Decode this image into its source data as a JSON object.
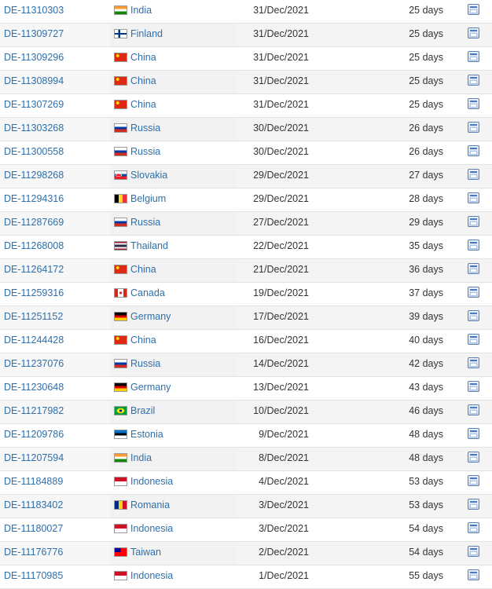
{
  "rows": [
    {
      "id": "DE-11310303",
      "country": "India",
      "flag_icon": "india-flag-icon",
      "date": "31/Dec/2021",
      "age": "25 days"
    },
    {
      "id": "DE-11309727",
      "country": "Finland",
      "flag_icon": "finland-flag-icon",
      "date": "31/Dec/2021",
      "age": "25 days"
    },
    {
      "id": "DE-11309296",
      "country": "China",
      "flag_icon": "china-flag-icon",
      "date": "31/Dec/2021",
      "age": "25 days"
    },
    {
      "id": "DE-11308994",
      "country": "China",
      "flag_icon": "china-flag-icon",
      "date": "31/Dec/2021",
      "age": "25 days"
    },
    {
      "id": "DE-11307269",
      "country": "China",
      "flag_icon": "china-flag-icon",
      "date": "31/Dec/2021",
      "age": "25 days"
    },
    {
      "id": "DE-11303268",
      "country": "Russia",
      "flag_icon": "russia-flag-icon",
      "date": "30/Dec/2021",
      "age": "26 days"
    },
    {
      "id": "DE-11300558",
      "country": "Russia",
      "flag_icon": "russia-flag-icon",
      "date": "30/Dec/2021",
      "age": "26 days"
    },
    {
      "id": "DE-11298268",
      "country": "Slovakia",
      "flag_icon": "slovakia-flag-icon",
      "date": "29/Dec/2021",
      "age": "27 days"
    },
    {
      "id": "DE-11294316",
      "country": "Belgium",
      "flag_icon": "belgium-flag-icon",
      "date": "29/Dec/2021",
      "age": "28 days"
    },
    {
      "id": "DE-11287669",
      "country": "Russia",
      "flag_icon": "russia-flag-icon",
      "date": "27/Dec/2021",
      "age": "29 days"
    },
    {
      "id": "DE-11268008",
      "country": "Thailand",
      "flag_icon": "thailand-flag-icon",
      "date": "22/Dec/2021",
      "age": "35 days"
    },
    {
      "id": "DE-11264172",
      "country": "China",
      "flag_icon": "china-flag-icon",
      "date": "21/Dec/2021",
      "age": "36 days"
    },
    {
      "id": "DE-11259316",
      "country": "Canada",
      "flag_icon": "canada-flag-icon",
      "date": "19/Dec/2021",
      "age": "37 days"
    },
    {
      "id": "DE-11251152",
      "country": "Germany",
      "flag_icon": "germany-flag-icon",
      "date": "17/Dec/2021",
      "age": "39 days"
    },
    {
      "id": "DE-11244428",
      "country": "China",
      "flag_icon": "china-flag-icon",
      "date": "16/Dec/2021",
      "age": "40 days"
    },
    {
      "id": "DE-11237076",
      "country": "Russia",
      "flag_icon": "russia-flag-icon",
      "date": "14/Dec/2021",
      "age": "42 days"
    },
    {
      "id": "DE-11230648",
      "country": "Germany",
      "flag_icon": "germany-flag-icon",
      "date": "13/Dec/2021",
      "age": "43 days"
    },
    {
      "id": "DE-11217982",
      "country": "Brazil",
      "flag_icon": "brazil-flag-icon",
      "date": "10/Dec/2021",
      "age": "46 days"
    },
    {
      "id": "DE-11209786",
      "country": "Estonia",
      "flag_icon": "estonia-flag-icon",
      "date": "9/Dec/2021",
      "age": "48 days"
    },
    {
      "id": "DE-11207594",
      "country": "India",
      "flag_icon": "india-flag-icon",
      "date": "8/Dec/2021",
      "age": "48 days"
    },
    {
      "id": "DE-11184889",
      "country": "Indonesia",
      "flag_icon": "indonesia-flag-icon",
      "date": "4/Dec/2021",
      "age": "53 days"
    },
    {
      "id": "DE-11183402",
      "country": "Romania",
      "flag_icon": "romania-flag-icon",
      "date": "3/Dec/2021",
      "age": "53 days"
    },
    {
      "id": "DE-11180027",
      "country": "Indonesia",
      "flag_icon": "indonesia-flag-icon",
      "date": "3/Dec/2021",
      "age": "54 days"
    },
    {
      "id": "DE-11176776",
      "country": "Taiwan",
      "flag_icon": "taiwan-flag-icon",
      "date": "2/Dec/2021",
      "age": "54 days"
    },
    {
      "id": "DE-11170985",
      "country": "Indonesia",
      "flag_icon": "indonesia-flag-icon",
      "date": "1/Dec/2021",
      "age": "55 days"
    }
  ],
  "view_icon": "document-view-icon",
  "colors": {
    "link": "#2f6fab",
    "text": "#333333",
    "row_border": "#e3e3e3"
  }
}
